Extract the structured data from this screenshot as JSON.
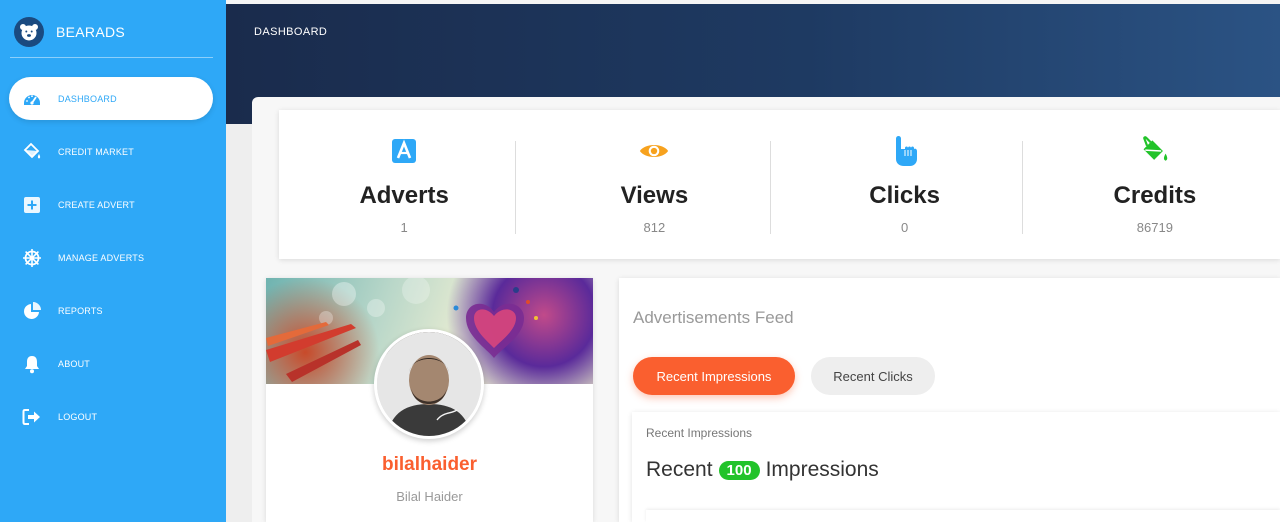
{
  "brand": {
    "name": "BEARADS"
  },
  "header": {
    "title": "DASHBOARD"
  },
  "sidebar": {
    "items": [
      {
        "label": "DASHBOARD",
        "icon": "dashboard-icon",
        "active": true
      },
      {
        "label": "CREDIT MARKET",
        "icon": "paint-bucket-icon",
        "active": false
      },
      {
        "label": "CREATE ADVERT",
        "icon": "plus-square-icon",
        "active": false
      },
      {
        "label": "MANAGE ADVERTS",
        "icon": "dharmachakra-icon",
        "active": false
      },
      {
        "label": "REPORTS",
        "icon": "pie-chart-icon",
        "active": false
      },
      {
        "label": "ABOUT",
        "icon": "bell-icon",
        "active": false
      },
      {
        "label": "LOGOUT",
        "icon": "logout-icon",
        "active": false
      }
    ]
  },
  "stats": [
    {
      "label": "Adverts",
      "value": "1",
      "icon": "app-store-icon",
      "color": "#2ea8f7"
    },
    {
      "label": "Views",
      "value": "812",
      "icon": "eye-icon",
      "color": "#f7a21e"
    },
    {
      "label": "Clicks",
      "value": "0",
      "icon": "pointing-hand-icon",
      "color": "#2ea8f7"
    },
    {
      "label": "Credits",
      "value": "86719",
      "icon": "paint-bucket-icon",
      "color": "#22c32a"
    }
  ],
  "profile": {
    "username": "bilalhaider",
    "full_name": "Bilal Haider"
  },
  "feed": {
    "title": "Advertisements Feed",
    "tabs": [
      {
        "label": "Recent Impressions",
        "active": true
      },
      {
        "label": "Recent Clicks",
        "active": false
      }
    ],
    "sub_label": "Recent Impressions",
    "heading_prefix": "Recent",
    "heading_count": "100",
    "heading_suffix": "Impressions"
  },
  "colors": {
    "sidebar": "#2ea8f7",
    "accent": "#fa5f2f",
    "badge": "#22c32a",
    "header": "#1a2b4c"
  }
}
